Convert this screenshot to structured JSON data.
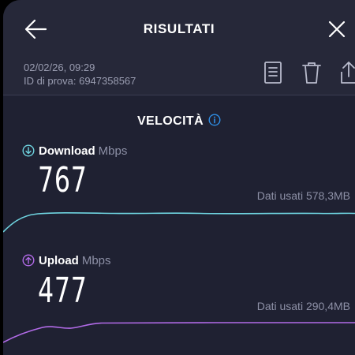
{
  "header": {
    "title": "RISULTATI",
    "back_icon": "arrow-left-icon",
    "close_icon": "close-icon"
  },
  "test_info": {
    "datetime": "02/02/26, 09:29",
    "test_id": "ID di prova: 6947358567"
  },
  "actions": [
    {
      "name": "details-icon"
    },
    {
      "name": "trash-icon"
    },
    {
      "name": "share-icon"
    }
  ],
  "section": {
    "title": "VELOCITÀ",
    "info_icon": "info-icon"
  },
  "download": {
    "label": "Download",
    "unit": "Mbps",
    "value": "767",
    "data_used": "Dati usati 578,3MB",
    "icon": "download-arrow-icon",
    "color": "#6fd4e0"
  },
  "upload": {
    "label": "Upload",
    "unit": "Mbps",
    "value": "477",
    "data_used": "Dati usati 290,4MB",
    "icon": "upload-arrow-icon",
    "color": "#b26be8"
  },
  "colors": {
    "background": "#1f2132",
    "header_background": "#262839",
    "muted_text": "#8d90a6",
    "info_accent": "#2f8fe6"
  }
}
